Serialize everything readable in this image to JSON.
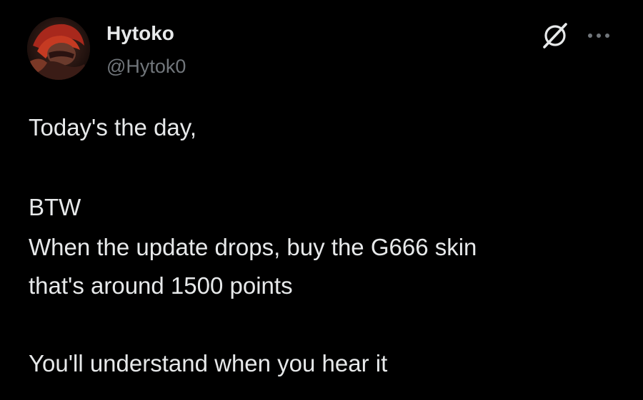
{
  "author": {
    "display_name": "Hytoko",
    "handle": "@Hytok0",
    "avatar_icon": "red-hooded-character-avatar"
  },
  "actions": {
    "grok_icon": "grok-slash-circle-icon",
    "more_icon": "more-dots-icon"
  },
  "post": {
    "lines": [
      "Today's the day,",
      "BTW",
      "When the update drops, buy the G666 skin",
      "that's around 1500 points",
      "You'll understand when you hear it"
    ]
  },
  "colors": {
    "background": "#000000",
    "primary_text": "#e7e9ea",
    "secondary_text": "#71767b"
  }
}
